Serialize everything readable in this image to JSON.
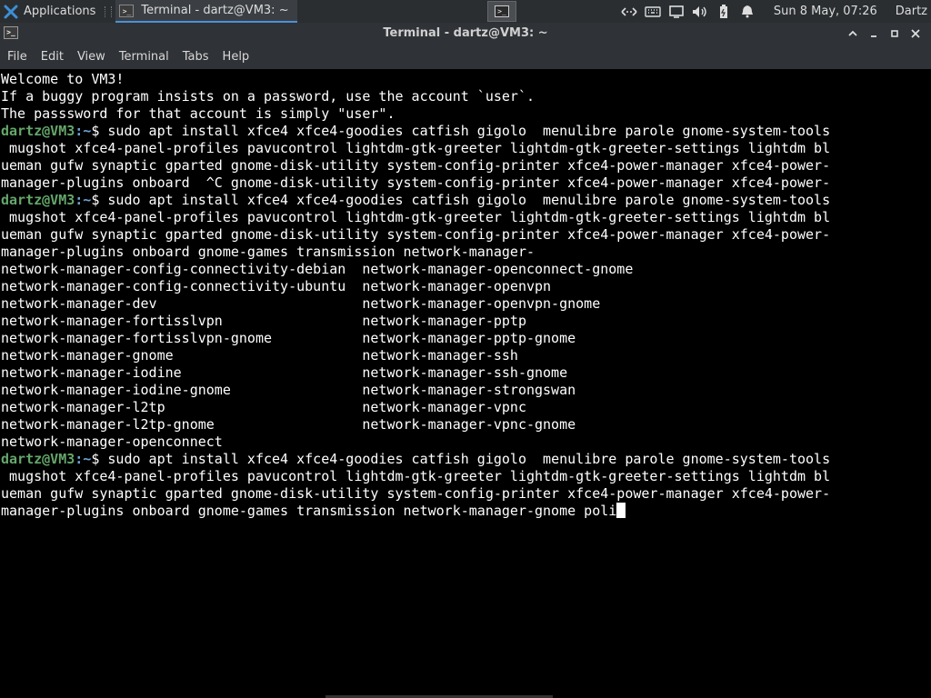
{
  "panel": {
    "apps_label": "Applications",
    "task_title": "Terminal - dartz@VM3: ~",
    "clock": "Sun  8 May, 07:26",
    "user": "Dartz",
    "tray_icons": [
      "network-icon",
      "keyboard-icon",
      "display-icon",
      "volume-icon",
      "battery-icon",
      "notifications-bell-icon"
    ]
  },
  "window": {
    "title": "Terminal - dartz@VM3: ~",
    "menu": [
      "File",
      "Edit",
      "View",
      "Terminal",
      "Tabs",
      "Help"
    ]
  },
  "terminal": {
    "prompt_user": "dartz@VM3",
    "prompt_path": ":~",
    "intro": [
      "Welcome to VM3!",
      "If a buggy program insists on a password, use the account `user`.",
      "The passsword for that account is simply \"user\"."
    ],
    "cmd1": [
      "$ sudo apt install xfce4 xfce4-goodies catfish gigolo  menulibre parole gnome-system-tools",
      " mugshot xfce4-panel-profiles pavucontrol lightdm-gtk-greeter lightdm-gtk-greeter-settings lightdm bl",
      "ueman gufw synaptic gparted gnome-disk-utility system-config-printer xfce4-power-manager xfce4-power-",
      "manager-plugins onboard  ^C gnome-disk-utility system-config-printer xfce4-power-manager xfce4-power-"
    ],
    "cmd2": [
      "$ sudo apt install xfce4 xfce4-goodies catfish gigolo  menulibre parole gnome-system-tools",
      " mugshot xfce4-panel-profiles pavucontrol lightdm-gtk-greeter lightdm-gtk-greeter-settings lightdm bl",
      "ueman gufw synaptic gparted gnome-disk-utility system-config-printer xfce4-power-manager xfce4-power-",
      "manager-plugins onboard gnome-games transmission network-manager-"
    ],
    "completions": [
      "network-manager-config-connectivity-debian  network-manager-openconnect-gnome",
      "network-manager-config-connectivity-ubuntu  network-manager-openvpn",
      "network-manager-dev                         network-manager-openvpn-gnome",
      "network-manager-fortisslvpn                 network-manager-pptp",
      "network-manager-fortisslvpn-gnome           network-manager-pptp-gnome",
      "network-manager-gnome                       network-manager-ssh",
      "network-manager-iodine                      network-manager-ssh-gnome",
      "network-manager-iodine-gnome                network-manager-strongswan",
      "network-manager-l2tp                        network-manager-vpnc",
      "network-manager-l2tp-gnome                  network-manager-vpnc-gnome",
      "network-manager-openconnect"
    ],
    "cmd3": [
      "$ sudo apt install xfce4 xfce4-goodies catfish gigolo  menulibre parole gnome-system-tools",
      " mugshot xfce4-panel-profiles pavucontrol lightdm-gtk-greeter lightdm-gtk-greeter-settings lightdm bl",
      "ueman gufw synaptic gparted gnome-disk-utility system-config-printer xfce4-power-manager xfce4-power-",
      "manager-plugins onboard gnome-games transmission network-manager-gnome poli"
    ]
  },
  "colors": {
    "prompt_user": "#64a66a",
    "prompt_path": "#6fa3d8",
    "panel_bg": "#2b2e31",
    "task_accent": "#4a90d9"
  }
}
